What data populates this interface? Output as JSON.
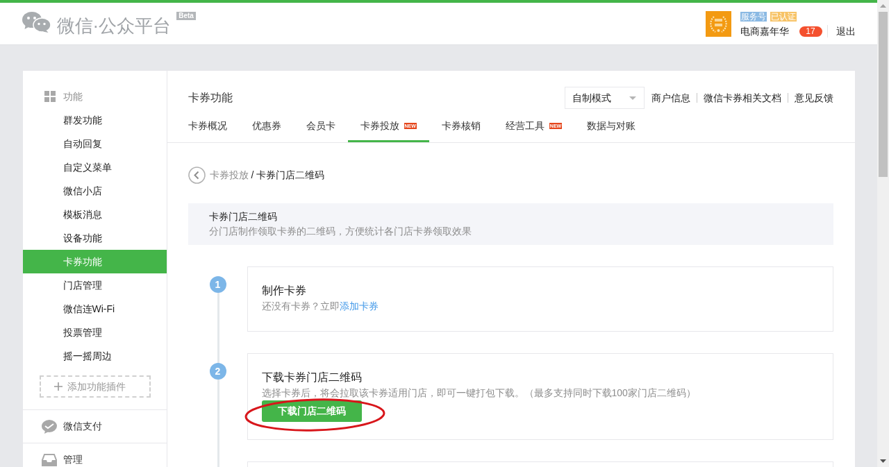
{
  "header": {
    "logo_title": "微信·公众平台",
    "beta_badge": "Beta",
    "account": {
      "tags": [
        {
          "label": "服务号",
          "color": "#8ab9e3"
        },
        {
          "label": "已认证",
          "color": "#f7c366"
        }
      ],
      "name": "电商嘉年华",
      "message_count": "17",
      "logout": "退出"
    }
  },
  "sidebar": {
    "sections": [
      {
        "title": "功能",
        "expanded": true,
        "items": [
          {
            "label": "群发功能",
            "selected": false
          },
          {
            "label": "自动回复",
            "selected": false
          },
          {
            "label": "自定义菜单",
            "selected": false
          },
          {
            "label": "微信小店",
            "selected": false
          },
          {
            "label": "模板消息",
            "selected": false
          },
          {
            "label": "设备功能",
            "selected": false
          },
          {
            "label": "卡券功能",
            "selected": true
          },
          {
            "label": "门店管理",
            "selected": false
          },
          {
            "label": "微信连Wi-Fi",
            "selected": false
          },
          {
            "label": "投票管理",
            "selected": false
          },
          {
            "label": "摇一摇周边",
            "selected": false
          }
        ],
        "add_plugin": "添加功能插件"
      },
      {
        "title": "微信支付",
        "expanded": false
      },
      {
        "title": "管理",
        "expanded": false
      }
    ]
  },
  "content": {
    "title": "卡券功能",
    "mode_select": {
      "value": "自制模式"
    },
    "links": [
      "商户信息",
      "微信卡券相关文档",
      "意见反馈"
    ],
    "tabs": [
      {
        "label": "卡券概况",
        "selected": false
      },
      {
        "label": "优惠券",
        "selected": false
      },
      {
        "label": "会员卡",
        "selected": false
      },
      {
        "label": "卡券投放",
        "selected": true,
        "badge": "NEW"
      },
      {
        "label": "卡券核销",
        "selected": false
      },
      {
        "label": "经营工具",
        "selected": false,
        "badge": "NEW"
      },
      {
        "label": "数据与对账",
        "selected": false
      }
    ],
    "breadcrumb": {
      "parent": "卡券投放",
      "separator": "/",
      "current": "卡券门店二维码"
    },
    "intro": {
      "title": "卡券门店二维码",
      "description": "分门店制作领取卡券的二维码，方便统计各门店卡券领取效果"
    },
    "steps": [
      {
        "number": "1",
        "title": "制作卡券",
        "text": "还没有卡券？立即",
        "link": "添加卡券",
        "highlighted": false
      },
      {
        "number": "2",
        "title": "下载卡券门店二维码",
        "text": "选择卡券后，将会拉取该卡券适用门店，即可一键打包下载。（最多支持同时下载100家门店二维码）",
        "button": "下载门店二维码",
        "highlighted": true
      }
    ]
  }
}
